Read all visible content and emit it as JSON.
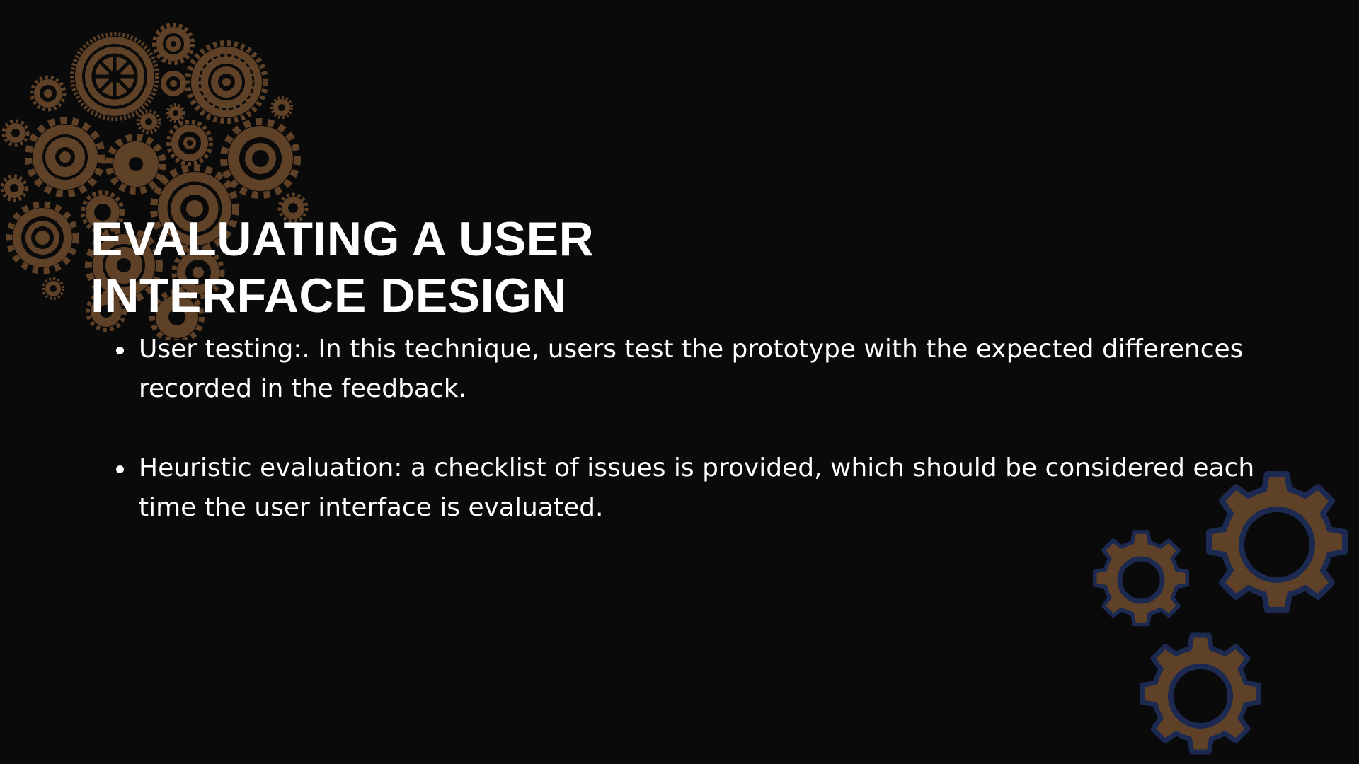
{
  "slide": {
    "title_lines": [
      "EVALUATING A USER",
      "INTERFACE DESIGN"
    ],
    "bullets": [
      "User testing:. In this technique, users test the prototype with the expected differences recorded in the feedback.",
      "Heuristic evaluation: a checklist of issues is provided, which should be considered each time the user interface is evaluated."
    ]
  },
  "colors": {
    "background": "#0a0a0a",
    "text": "#ffffff",
    "gear_brown": "#5e4126",
    "gear_outline_navy": "#1c2a52"
  },
  "decorations": {
    "top_left": "gear-cluster-icon",
    "bottom_right": "gears-icon"
  }
}
